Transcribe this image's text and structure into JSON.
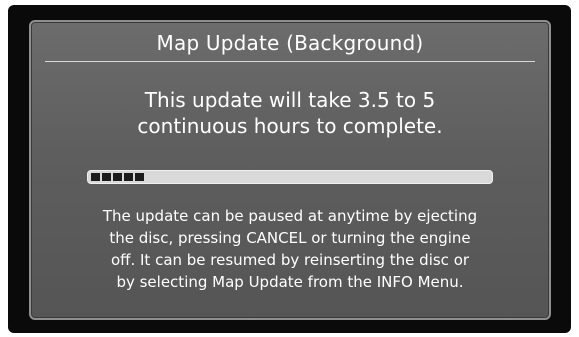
{
  "dialog": {
    "title": "Map Update (Background)",
    "message_lines": [
      "This update will take 3.5 to 5",
      "continuous hours to complete."
    ],
    "progress": {
      "fraction": 0.13,
      "segments_filled": 5
    },
    "note_lines": [
      "The update can be paused at anytime by ejecting",
      "the disc, pressing CANCEL or turning the engine",
      "off. It can be resumed by reinserting the disc or",
      "by selecting Map Update from the INFO Menu."
    ]
  },
  "colors": {
    "panel": "#5e5e5e",
    "bezel": "#0a0a0a",
    "text": "#ffffff",
    "progress_track": "#d9d9d9",
    "progress_fill": "#1c1c1c"
  }
}
